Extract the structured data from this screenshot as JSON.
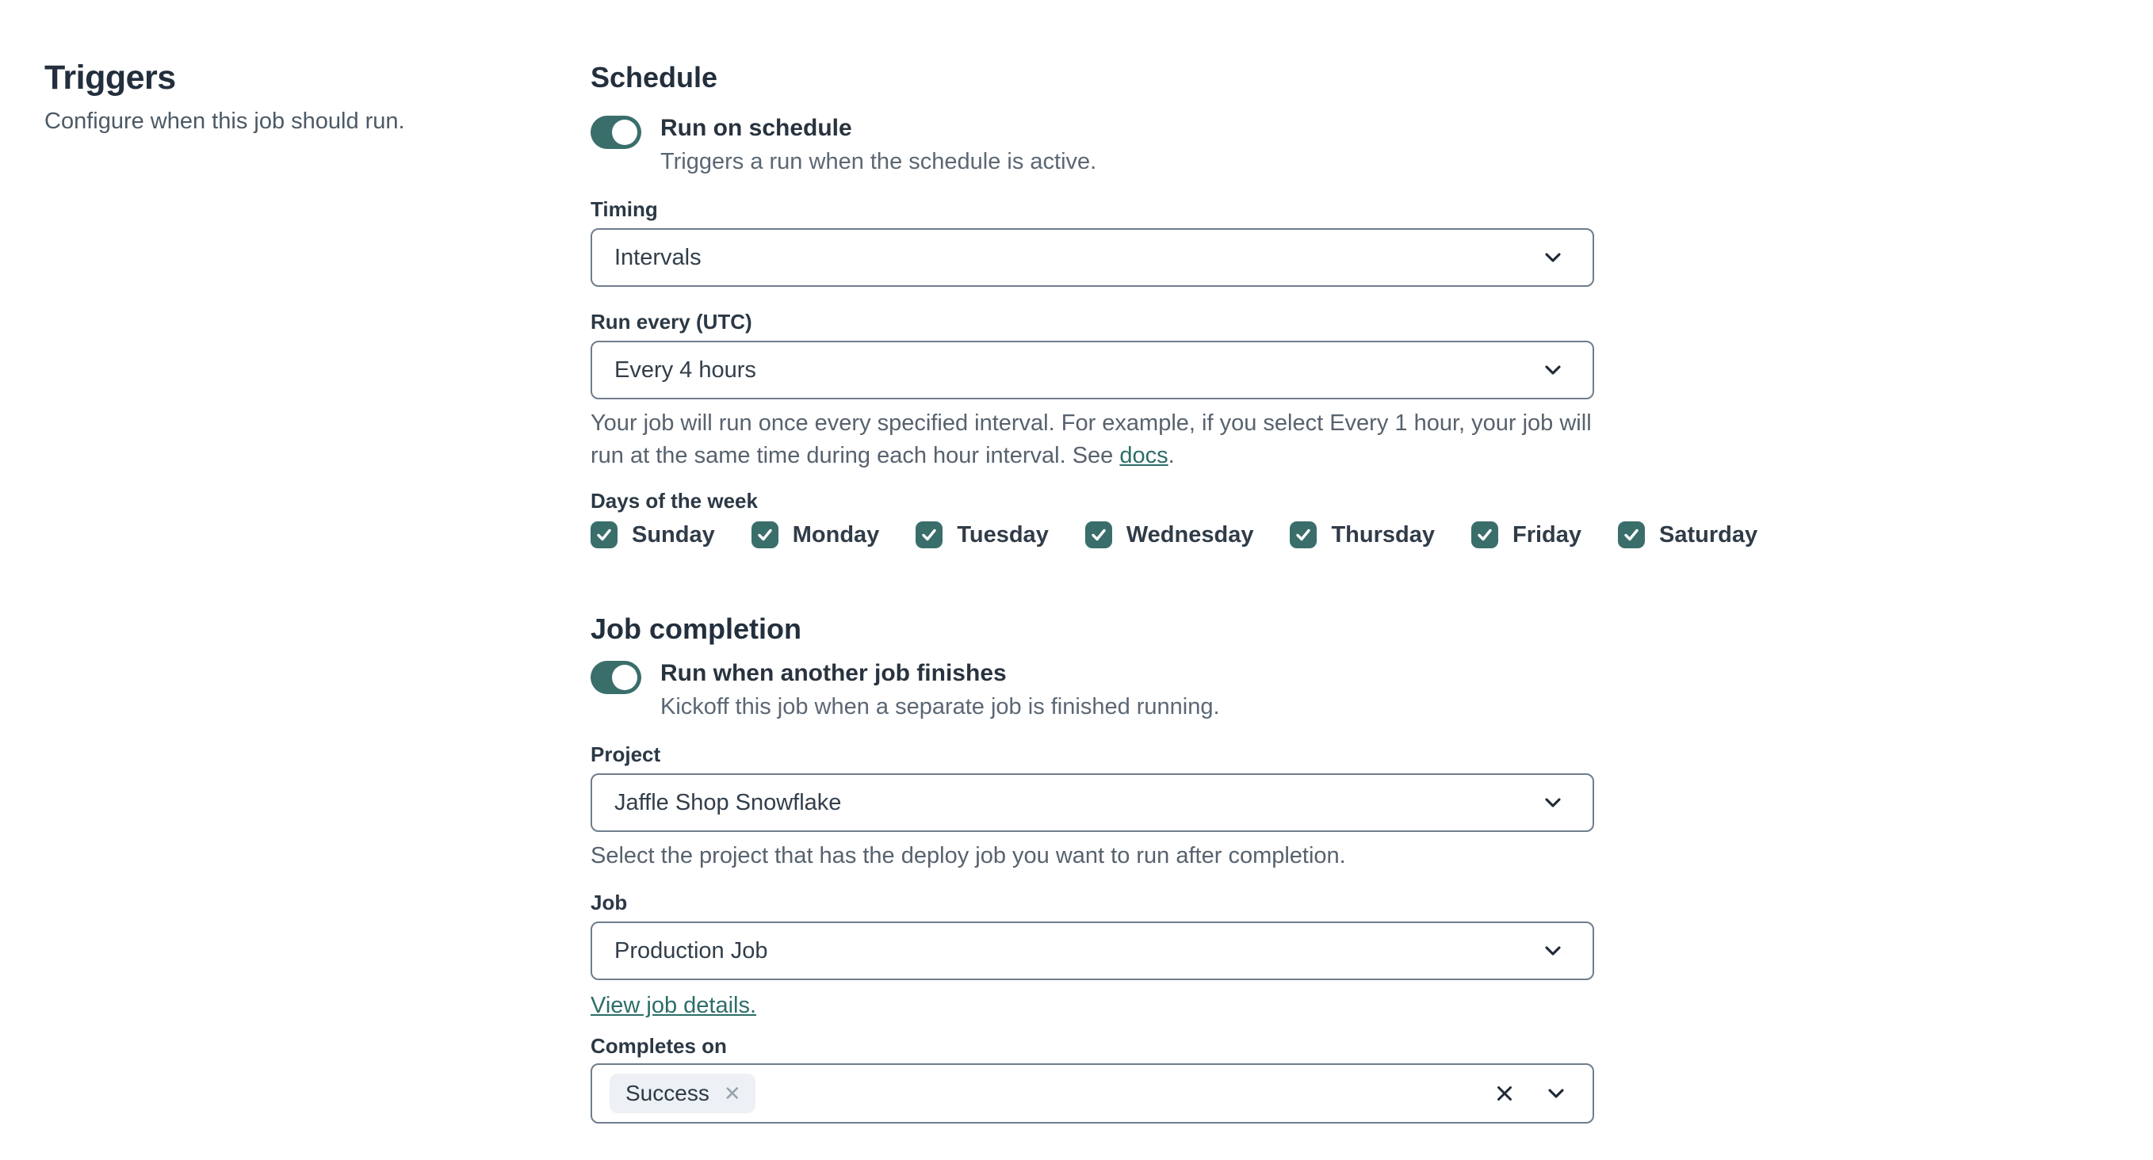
{
  "colors": {
    "accent_teal": "#396e6b",
    "link_teal": "#2d6e68",
    "heading_text": "#232f3d",
    "body_gray": "#57626e",
    "field_border": "#6f7d8c",
    "tag_background": "#edf0f4"
  },
  "left_panel": {
    "title": "Triggers",
    "description": "Configure when this job should run."
  },
  "schedule": {
    "heading": "Schedule",
    "run_on_schedule": {
      "label": "Run on schedule",
      "description": "Triggers a run when the schedule is active.",
      "enabled": true
    },
    "timing": {
      "label": "Timing",
      "value": "Intervals"
    },
    "run_every": {
      "label": "Run every (UTC)",
      "value": "Every 4 hours",
      "help_text_before_link": "Your job will run once every specified interval. For example, if you select Every 1 hour, your job will run at the same time during each hour interval. See ",
      "help_link_text": "docs",
      "help_text_after_link": "."
    },
    "days_of_week": {
      "label": "Days of the week",
      "items": [
        {
          "label": "Sunday",
          "checked": true
        },
        {
          "label": "Monday",
          "checked": true
        },
        {
          "label": "Tuesday",
          "checked": true
        },
        {
          "label": "Wednesday",
          "checked": true
        },
        {
          "label": "Thursday",
          "checked": true
        },
        {
          "label": "Friday",
          "checked": true
        },
        {
          "label": "Saturday",
          "checked": true
        }
      ]
    }
  },
  "job_completion": {
    "heading": "Job completion",
    "run_when_finishes": {
      "label": "Run when another job finishes",
      "description": "Kickoff this job when a separate job is finished running.",
      "enabled": true
    },
    "project": {
      "label": "Project",
      "value": "Jaffle Shop Snowflake",
      "help_text": "Select the project that has the deploy job you want to run after completion."
    },
    "job": {
      "label": "Job",
      "value": "Production Job",
      "link_text": "View job details."
    },
    "completes_on": {
      "label": "Completes on",
      "selected": [
        {
          "label": "Success"
        }
      ]
    }
  },
  "icons": {
    "chevron_down": "v",
    "clear": "✕",
    "tag_remove": "✕",
    "checkmark": "✓"
  }
}
